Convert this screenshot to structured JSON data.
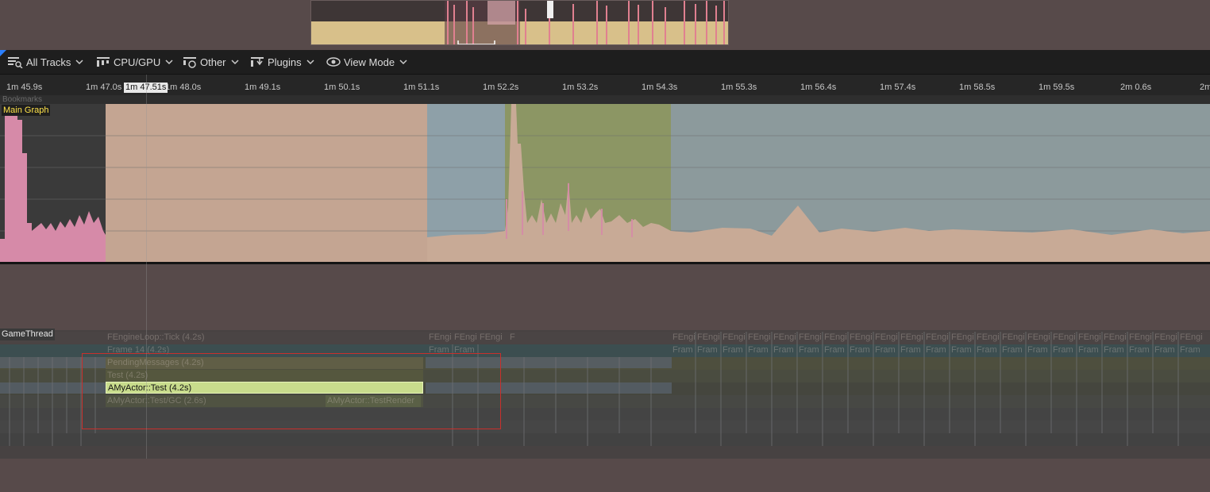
{
  "toolbar": {
    "all_tracks": "All Tracks",
    "cpu_gpu": "CPU/GPU",
    "other": "Other",
    "plugins": "Plugins",
    "view_mode": "View Mode"
  },
  "ruler": {
    "labels": [
      "1m 45.9s",
      "1m 47.0s",
      "1m 48.0s",
      "1m 49.1s",
      "1m 50.1s",
      "1m 51.1s",
      "1m 52.2s",
      "1m 53.2s",
      "1m 54.3s",
      "1m 55.3s",
      "1m 56.4s",
      "1m 57.4s",
      "1m 58.5s",
      "1m 59.5s",
      "2m 0.6s",
      "2m"
    ],
    "cursor_time": "1m 47.51s"
  },
  "bookmarks_label": "Bookmarks",
  "graph": {
    "title": "Main Graph"
  },
  "thread": {
    "name": "GameThread",
    "events": {
      "engine_tick": "FEngineLoop::Tick (4.2s)",
      "frame": "Frame 14 (4.2s)",
      "messages": "PendingMessages (4.2s)",
      "test_parent": "Test (4.2s)",
      "selected": "AMyActor::Test (4.2s)",
      "sub_a": "AMyActor::Test/GC (2.6s)",
      "sub_b": "AMyActor::TestRender",
      "short": "FEngi",
      "short_frame": "Fram",
      "short_f": "F"
    }
  },
  "colors": {
    "graph_pink": "#d88aa6",
    "graph_beige": "#c8a992",
    "graph_blue": "#8ea4ac",
    "graph_green": "#8a9660",
    "selected_event": "#c8dc8c",
    "selection_border": "#c8302c",
    "graph_title": "#ffe34a"
  }
}
